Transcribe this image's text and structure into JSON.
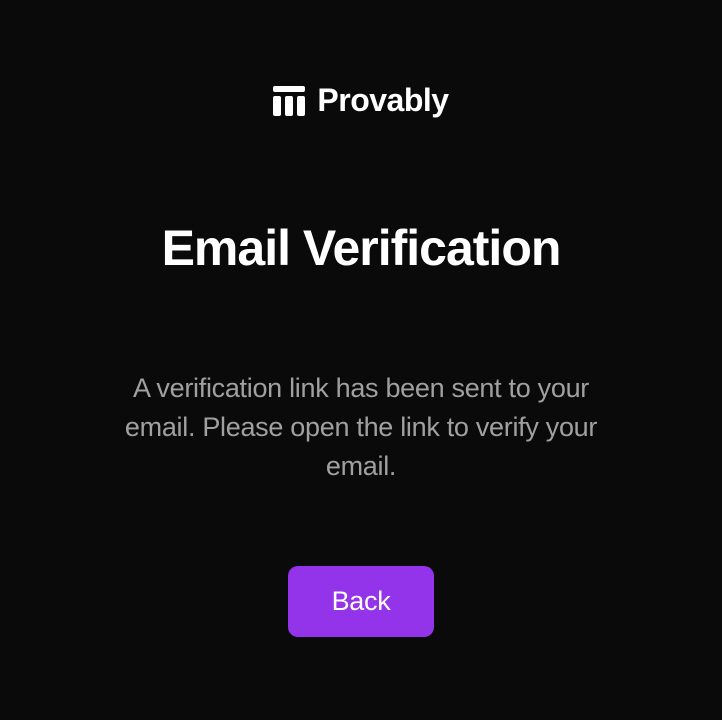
{
  "brand": {
    "name": "Provably"
  },
  "page": {
    "title": "Email Verification",
    "description": "A verification link has been sent to your email. Please open the link to verify your email."
  },
  "actions": {
    "back_label": "Back"
  },
  "colors": {
    "accent": "#9333ea",
    "background": "#0a0a0a",
    "text_primary": "#ffffff",
    "text_secondary": "#a0a0a0"
  }
}
